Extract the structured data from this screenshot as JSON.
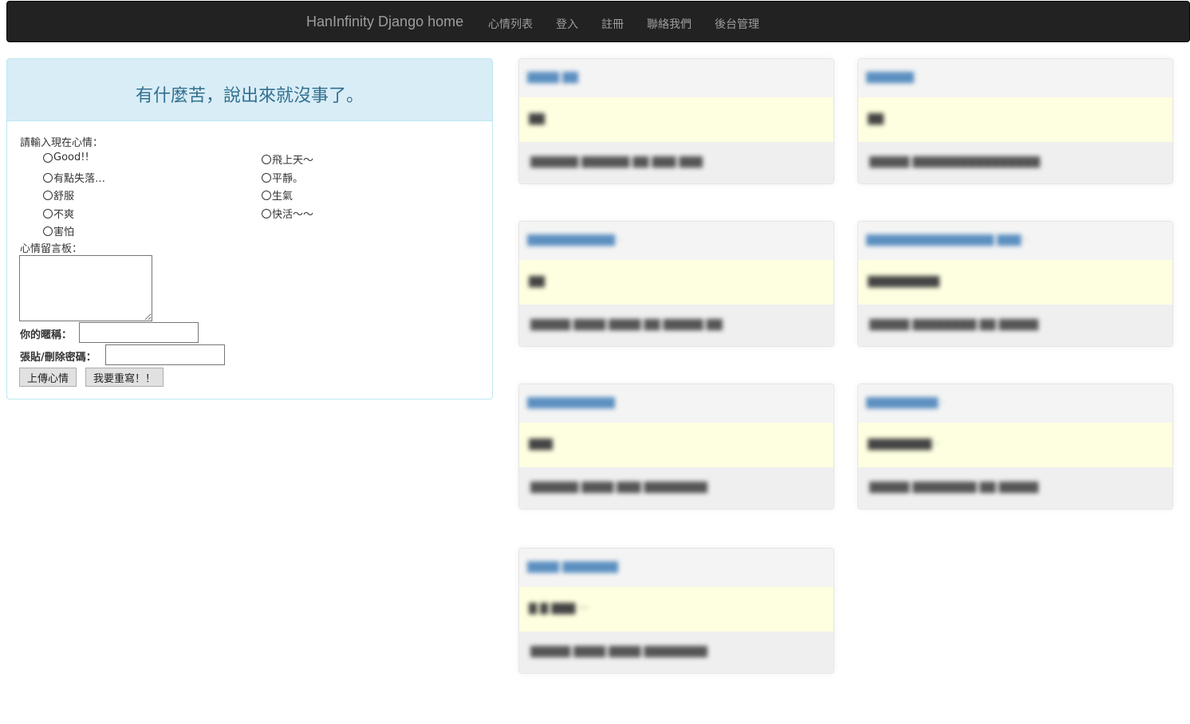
{
  "navbar": {
    "brand": "HanInfinity Django home",
    "links": [
      "心情列表",
      "登入",
      "註冊",
      "聯絡我們",
      "後台管理"
    ]
  },
  "panel": {
    "title": "有什麼苦，說出來就沒事了。",
    "mood_prompt": "請輸入現在心情：",
    "moods_left": [
      "Good!!",
      "有點失落…",
      "舒服",
      "不爽",
      "害怕"
    ],
    "moods_right": [
      "飛上天～",
      "平靜。",
      "生氣",
      "快活～～"
    ],
    "message_label": "心情留言板：",
    "nickname_label": "你的暱稱：",
    "password_label": "張貼/刪除密碼：",
    "nickname_value": "",
    "password_value": "",
    "upload_button": "上傳心情",
    "reset_button": "我要重寫！！"
  },
  "posts": [
    {
      "head": "████ ██",
      "mood": "██",
      "foot": "██████ ██████ ██ ███ ███"
    },
    {
      "head": "██████",
      "mood": "██",
      "foot": "█████ ████████████████"
    },
    {
      "head": "███████████ ·",
      "mood": "██",
      "foot": "█████ ████ ████ ██ █████ ██"
    },
    {
      "head": "████████████████ ███ ·",
      "mood": "█████████",
      "foot": "█████ ████████ ██ █████"
    },
    {
      "head": "███████████",
      "mood": "███",
      "foot": "██████ ████ ███ ████████"
    },
    {
      "head": "█████████ ·",
      "mood": "████████ ·",
      "foot": "█████ ████████ ██ █████"
    },
    {
      "head": "████ ███████",
      "mood": "█ █ ███ ···",
      "foot": "█████ ████ ████ ████████"
    }
  ]
}
